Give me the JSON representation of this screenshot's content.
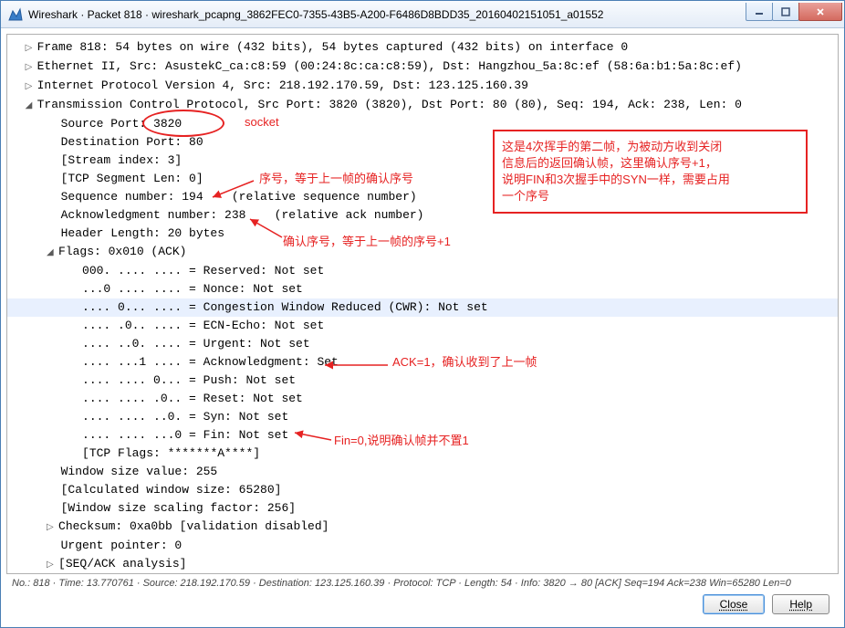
{
  "window": {
    "app_name": "Wireshark",
    "title": "Wireshark · Packet 818 · wireshark_pcapng_3862FEC0-7355-43B5-A200-F6486D8BDD35_20160402151051_a01552"
  },
  "tree": {
    "frame": "Frame 818: 54 bytes on wire (432 bits), 54 bytes captured (432 bits) on interface 0",
    "ethernet": "Ethernet II, Src: AsustekC_ca:c8:59 (00:24:8c:ca:c8:59), Dst: Hangzhou_5a:8c:ef (58:6a:b1:5a:8c:ef)",
    "ip": "Internet Protocol Version 4, Src: 218.192.170.59, Dst: 123.125.160.39",
    "tcp": "Transmission Control Protocol, Src Port: 3820 (3820), Dst Port: 80 (80), Seq: 194, Ack: 238, Len: 0",
    "src_port": "Source Port: 3820",
    "dst_port": "Destination Port: 80",
    "stream": "[Stream index: 3]",
    "seglen": "[TCP Segment Len: 0]",
    "seqnum": "Sequence number: 194    (relative sequence number)",
    "acknum": "Acknowledgment number: 238    (relative ack number)",
    "hdrlen": "Header Length: 20 bytes",
    "flags": "Flags: 0x010 (ACK)",
    "f_reserved": "000. .... .... = Reserved: Not set",
    "f_nonce": "...0 .... .... = Nonce: Not set",
    "f_cwr": ".... 0... .... = Congestion Window Reduced (CWR): Not set",
    "f_ecn": ".... .0.. .... = ECN-Echo: Not set",
    "f_urg": ".... ..0. .... = Urgent: Not set",
    "f_ack": ".... ...1 .... = Acknowledgment: Set",
    "f_psh": ".... .... 0... = Push: Not set",
    "f_rst": ".... .... .0.. = Reset: Not set",
    "f_syn": ".... .... ..0. = Syn: Not set",
    "f_fin": ".... .... ...0 = Fin: Not set",
    "f_tcpflags": "[TCP Flags: *******A****]",
    "win": "Window size value: 255",
    "calcwin": "[Calculated window size: 65280]",
    "scaling": "[Window size scaling factor: 256]",
    "checksum": "Checksum: 0xa0bb [validation disabled]",
    "urgptr": "Urgent pointer: 0",
    "seqack": "[SEQ/ACK analysis]"
  },
  "annotations": {
    "socket": "socket",
    "seq_note": "序号，等于上一帧的确认序号",
    "ack_note": "确认序号，等于上一帧的序号+1",
    "ack_flag_note": "ACK=1，确认收到了上一帧",
    "fin_note": "Fin=0,说明确认帧并不置1",
    "box_l1": "这是4次挥手的第二帧，为被动方收到关闭",
    "box_l2": "信息后的返回确认帧，这里确认序号+1，",
    "box_l3": "说明FIN和3次握手中的SYN一样，需要占用",
    "box_l4": "一个序号"
  },
  "status": "No.: 818 · Time: 13.770761 · Source: 218.192.170.59 · Destination: 123.125.160.39 · Protocol: TCP · Length: 54 · Info: 3820 → 80 [ACK] Seq=194 Ack=238 Win=65280 Len=0",
  "buttons": {
    "close": "Close",
    "help": "Help"
  },
  "colors": {
    "annotation": "#e62222"
  }
}
